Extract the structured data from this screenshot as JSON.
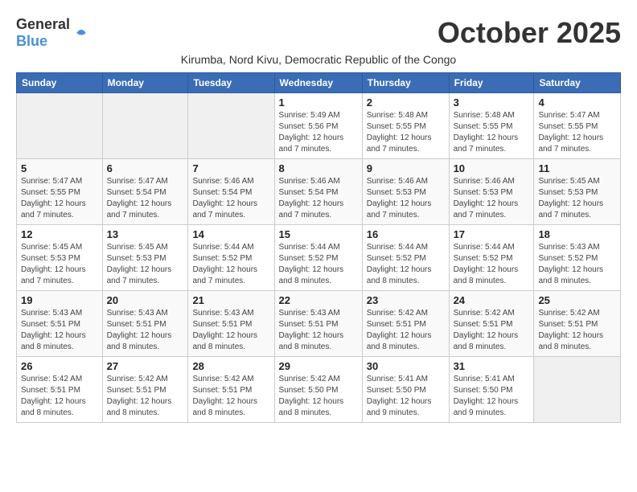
{
  "header": {
    "logo_general": "General",
    "logo_blue": "Blue",
    "month_title": "October 2025",
    "subtitle": "Kirumba, Nord Kivu, Democratic Republic of the Congo"
  },
  "weekdays": [
    "Sunday",
    "Monday",
    "Tuesday",
    "Wednesday",
    "Thursday",
    "Friday",
    "Saturday"
  ],
  "weeks": [
    [
      {
        "day": "",
        "info": ""
      },
      {
        "day": "",
        "info": ""
      },
      {
        "day": "",
        "info": ""
      },
      {
        "day": "1",
        "info": "Sunrise: 5:49 AM\nSunset: 5:56 PM\nDaylight: 12 hours\nand 7 minutes."
      },
      {
        "day": "2",
        "info": "Sunrise: 5:48 AM\nSunset: 5:55 PM\nDaylight: 12 hours\nand 7 minutes."
      },
      {
        "day": "3",
        "info": "Sunrise: 5:48 AM\nSunset: 5:55 PM\nDaylight: 12 hours\nand 7 minutes."
      },
      {
        "day": "4",
        "info": "Sunrise: 5:47 AM\nSunset: 5:55 PM\nDaylight: 12 hours\nand 7 minutes."
      }
    ],
    [
      {
        "day": "5",
        "info": "Sunrise: 5:47 AM\nSunset: 5:55 PM\nDaylight: 12 hours\nand 7 minutes."
      },
      {
        "day": "6",
        "info": "Sunrise: 5:47 AM\nSunset: 5:54 PM\nDaylight: 12 hours\nand 7 minutes."
      },
      {
        "day": "7",
        "info": "Sunrise: 5:46 AM\nSunset: 5:54 PM\nDaylight: 12 hours\nand 7 minutes."
      },
      {
        "day": "8",
        "info": "Sunrise: 5:46 AM\nSunset: 5:54 PM\nDaylight: 12 hours\nand 7 minutes."
      },
      {
        "day": "9",
        "info": "Sunrise: 5:46 AM\nSunset: 5:53 PM\nDaylight: 12 hours\nand 7 minutes."
      },
      {
        "day": "10",
        "info": "Sunrise: 5:46 AM\nSunset: 5:53 PM\nDaylight: 12 hours\nand 7 minutes."
      },
      {
        "day": "11",
        "info": "Sunrise: 5:45 AM\nSunset: 5:53 PM\nDaylight: 12 hours\nand 7 minutes."
      }
    ],
    [
      {
        "day": "12",
        "info": "Sunrise: 5:45 AM\nSunset: 5:53 PM\nDaylight: 12 hours\nand 7 minutes."
      },
      {
        "day": "13",
        "info": "Sunrise: 5:45 AM\nSunset: 5:53 PM\nDaylight: 12 hours\nand 7 minutes."
      },
      {
        "day": "14",
        "info": "Sunrise: 5:44 AM\nSunset: 5:52 PM\nDaylight: 12 hours\nand 7 minutes."
      },
      {
        "day": "15",
        "info": "Sunrise: 5:44 AM\nSunset: 5:52 PM\nDaylight: 12 hours\nand 8 minutes."
      },
      {
        "day": "16",
        "info": "Sunrise: 5:44 AM\nSunset: 5:52 PM\nDaylight: 12 hours\nand 8 minutes."
      },
      {
        "day": "17",
        "info": "Sunrise: 5:44 AM\nSunset: 5:52 PM\nDaylight: 12 hours\nand 8 minutes."
      },
      {
        "day": "18",
        "info": "Sunrise: 5:43 AM\nSunset: 5:52 PM\nDaylight: 12 hours\nand 8 minutes."
      }
    ],
    [
      {
        "day": "19",
        "info": "Sunrise: 5:43 AM\nSunset: 5:51 PM\nDaylight: 12 hours\nand 8 minutes."
      },
      {
        "day": "20",
        "info": "Sunrise: 5:43 AM\nSunset: 5:51 PM\nDaylight: 12 hours\nand 8 minutes."
      },
      {
        "day": "21",
        "info": "Sunrise: 5:43 AM\nSunset: 5:51 PM\nDaylight: 12 hours\nand 8 minutes."
      },
      {
        "day": "22",
        "info": "Sunrise: 5:43 AM\nSunset: 5:51 PM\nDaylight: 12 hours\nand 8 minutes."
      },
      {
        "day": "23",
        "info": "Sunrise: 5:42 AM\nSunset: 5:51 PM\nDaylight: 12 hours\nand 8 minutes."
      },
      {
        "day": "24",
        "info": "Sunrise: 5:42 AM\nSunset: 5:51 PM\nDaylight: 12 hours\nand 8 minutes."
      },
      {
        "day": "25",
        "info": "Sunrise: 5:42 AM\nSunset: 5:51 PM\nDaylight: 12 hours\nand 8 minutes."
      }
    ],
    [
      {
        "day": "26",
        "info": "Sunrise: 5:42 AM\nSunset: 5:51 PM\nDaylight: 12 hours\nand 8 minutes."
      },
      {
        "day": "27",
        "info": "Sunrise: 5:42 AM\nSunset: 5:51 PM\nDaylight: 12 hours\nand 8 minutes."
      },
      {
        "day": "28",
        "info": "Sunrise: 5:42 AM\nSunset: 5:51 PM\nDaylight: 12 hours\nand 8 minutes."
      },
      {
        "day": "29",
        "info": "Sunrise: 5:42 AM\nSunset: 5:50 PM\nDaylight: 12 hours\nand 8 minutes."
      },
      {
        "day": "30",
        "info": "Sunrise: 5:41 AM\nSunset: 5:50 PM\nDaylight: 12 hours\nand 9 minutes."
      },
      {
        "day": "31",
        "info": "Sunrise: 5:41 AM\nSunset: 5:50 PM\nDaylight: 12 hours\nand 9 minutes."
      },
      {
        "day": "",
        "info": ""
      }
    ]
  ]
}
